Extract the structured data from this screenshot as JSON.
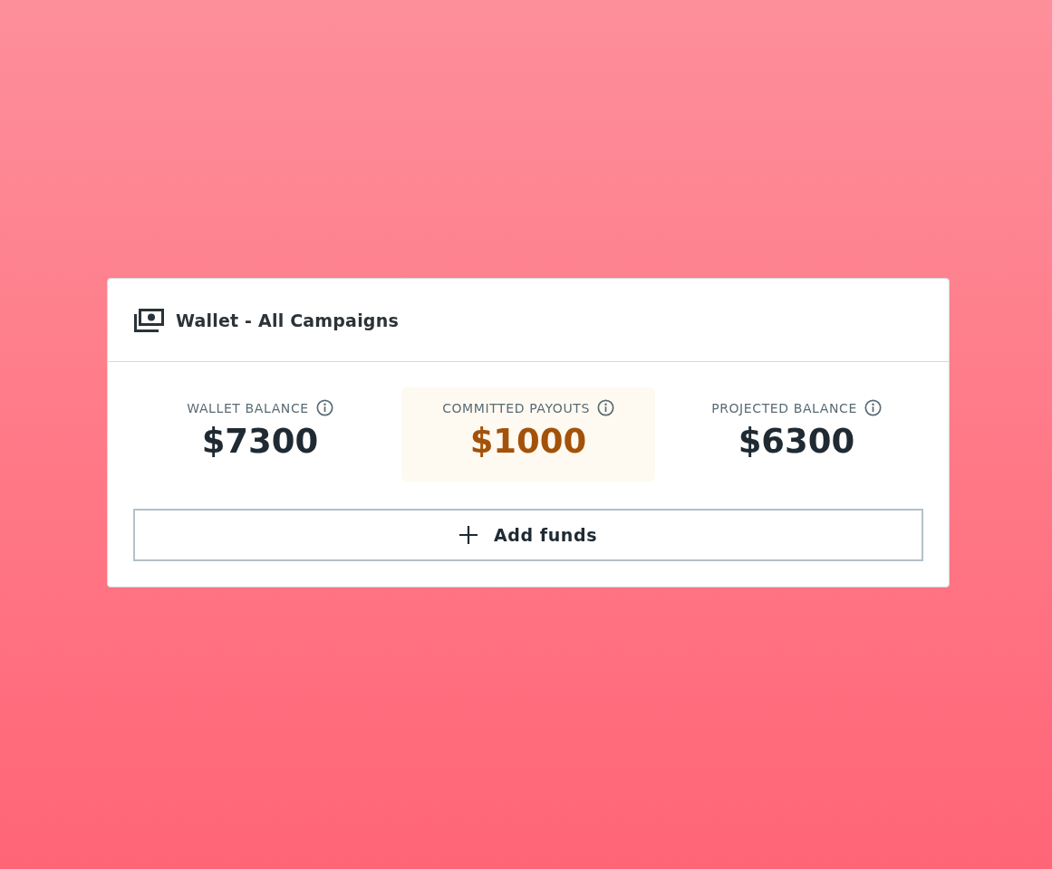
{
  "card": {
    "title": "Wallet - All Campaigns"
  },
  "stats": [
    {
      "label": "WALLET BALANCE",
      "value": "$7300",
      "highlighted": false
    },
    {
      "label": "COMMITTED PAYOUTS",
      "value": "$1000",
      "highlighted": true
    },
    {
      "label": "PROJECTED BALANCE",
      "value": "$6300",
      "highlighted": false
    }
  ],
  "add_button": {
    "label": "Add funds"
  }
}
